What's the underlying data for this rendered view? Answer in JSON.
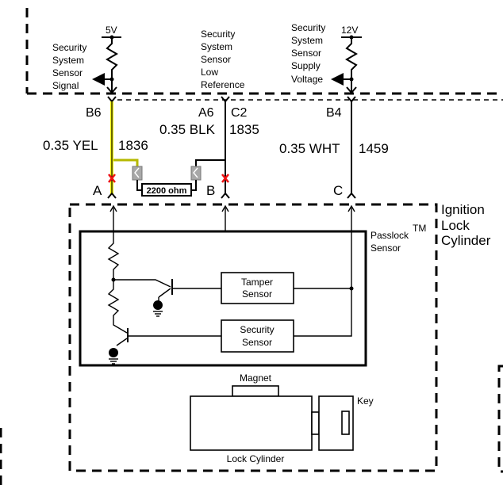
{
  "module": {
    "signal": {
      "label_lines": [
        "Security",
        "System",
        "Sensor",
        "Signal"
      ],
      "voltage": "5V",
      "pin": "B6"
    },
    "low_ref": {
      "label_lines": [
        "Security",
        "System",
        "Sensor",
        "Low",
        "Reference"
      ],
      "pin_a": "A6",
      "pin_c": "C2"
    },
    "supply": {
      "label_lines": [
        "Security",
        "System",
        "Sensor",
        "Supply",
        "Voltage"
      ],
      "voltage": "12V",
      "pin": "B4"
    }
  },
  "wires": [
    {
      "gauge_color": "0.35 YEL",
      "circuit": "1836",
      "color": "#ffff00",
      "end_pin": "A"
    },
    {
      "gauge_color": "0.35 BLK",
      "circuit": "1835",
      "color": "#000000",
      "end_pin": "B"
    },
    {
      "gauge_color": "0.35 WHT",
      "circuit": "1459",
      "color": "#000000",
      "end_pin": "C"
    }
  ],
  "bypass": {
    "resistor_label": "2200 ohm",
    "resistor_color": "#dd1111",
    "tap_wire_color": "#b5b800",
    "cut_mark_color": "#ee1111",
    "connector_color": "#a8a8a8"
  },
  "ignition": {
    "title_lines": [
      "Ignition",
      "Lock",
      "Cylinder"
    ],
    "passlock_lines": [
      "Passlock",
      "Sensor"
    ],
    "trademark": "TM",
    "tamper_lines": [
      "Tamper",
      "Sensor"
    ],
    "security_lines": [
      "Security",
      "Sensor"
    ],
    "magnet": "Magnet",
    "key": "Key",
    "lock_cylinder": "Lock Cylinder"
  }
}
